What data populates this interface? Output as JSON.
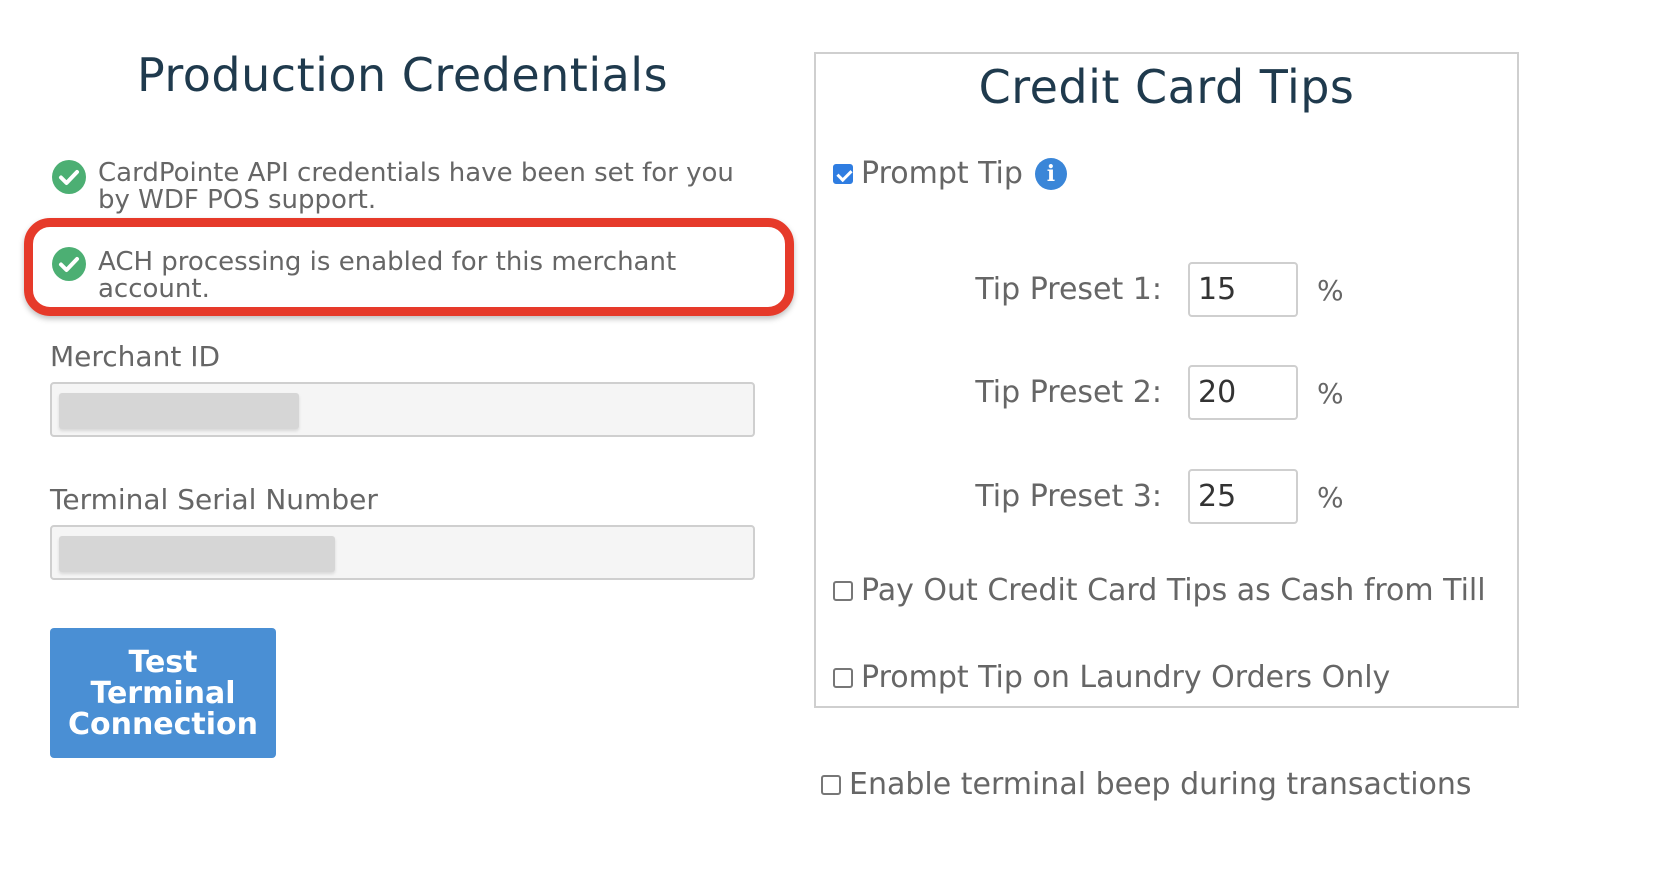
{
  "production": {
    "title": "Production Credentials",
    "status_messages": [
      "CardPointe API credentials have been set for you by WDF POS support.",
      "ACH processing is enabled for this merchant account."
    ],
    "merchant_id": {
      "label": "Merchant ID",
      "value": ""
    },
    "terminal_serial": {
      "label": "Terminal Serial Number",
      "value": ""
    },
    "test_button_label": "Test Terminal Connection"
  },
  "tips": {
    "title": "Credit Card Tips",
    "prompt_tip": {
      "label": "Prompt Tip",
      "checked": true
    },
    "presets": [
      {
        "label": "Tip Preset 1:",
        "value": "15",
        "unit": "%"
      },
      {
        "label": "Tip Preset 2:",
        "value": "20",
        "unit": "%"
      },
      {
        "label": "Tip Preset 3:",
        "value": "25",
        "unit": "%"
      }
    ],
    "payout_as_cash": {
      "label": "Pay Out Credit Card Tips as Cash from Till",
      "checked": false
    },
    "laundry_only": {
      "label": "Prompt Tip on Laundry Orders Only",
      "checked": false
    }
  },
  "terminal_beep": {
    "label": "Enable terminal beep during transactions",
    "checked": false
  },
  "colors": {
    "success": "#4caf73",
    "highlight": "#e63a2a",
    "primary_button": "#4a8fd4",
    "heading": "#1f3a4d",
    "info": "#3a86d8"
  },
  "icons": {
    "status": "check-circle-icon",
    "info": "info-icon"
  }
}
